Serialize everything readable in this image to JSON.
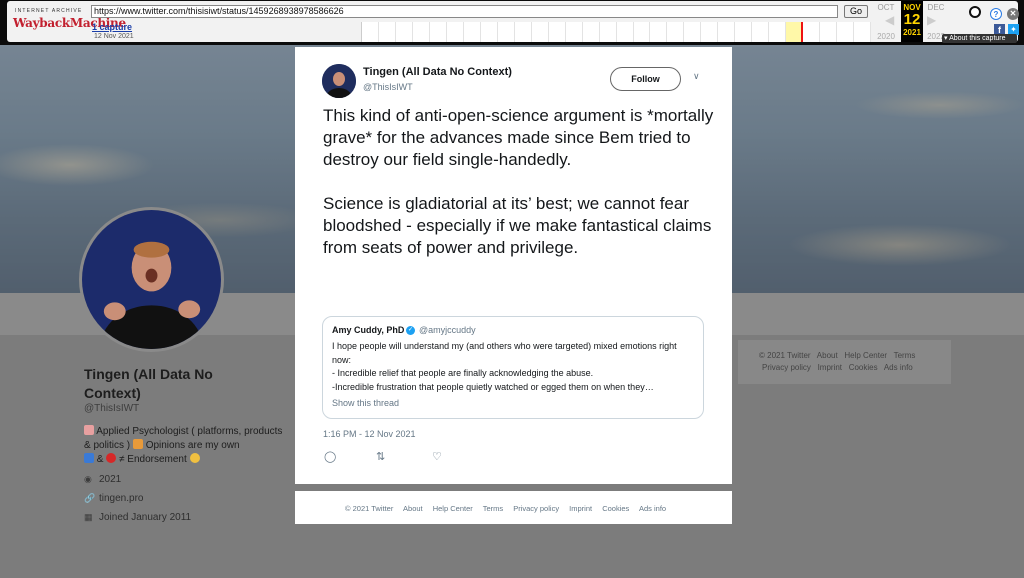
{
  "wayback": {
    "logo_top": "INTERNET ARCHIVE",
    "logo_main": "WaybackMachine",
    "url": "https://www.twitter.com/thisisiwt/status/1459268938978586626",
    "go_label": "Go",
    "captures_label": "1 capture",
    "capture_date": "12 Nov 2021",
    "prev_month": "OCT",
    "cur_month": "NOV",
    "next_month": "DEC",
    "cur_day": "12",
    "prev_year": "2020",
    "cur_year": "2021",
    "next_year": "2022",
    "about_label": "About this capture"
  },
  "profile": {
    "name": "Tingen (All Data No Context)",
    "handle": "@ThisIsIWT",
    "bio_line1": "Applied Psychologist ( platforms, products & politics )",
    "bio_line1_tail": "Opinions are my own",
    "bio_line2": "&",
    "bio_line2_tail": "≠ Endorsement",
    "location": "2021",
    "website": "tingen.pro",
    "joined": "Joined January 2011"
  },
  "side_footer": {
    "row1": [
      "© 2021 Twitter",
      "About",
      "Help Center",
      "Terms"
    ],
    "row2": [
      "Privacy policy",
      "Imprint",
      "Cookies",
      "Ads info"
    ]
  },
  "tweet": {
    "author_name": "Tingen (All Data No Context)",
    "author_handle": "@ThisIsIWT",
    "follow_label": "Follow",
    "body": "This kind of anti-open-science argument is *mortally grave* for the advances made since Bem tried to destroy our field single-handedly.\n\nScience is gladiatorial at its’ best; we cannot fear bloodshed - especially if we make fantastical claims from seats of power and privilege.",
    "timestamp": "1:16 PM - 12 Nov 2021"
  },
  "quote": {
    "author_name": "Amy Cuddy, PhD",
    "author_handle": "@amyjccuddy",
    "line1": "I hope people will understand my (and others who were targeted) mixed emotions right now:",
    "line2": "- Incredible relief that people are finally acknowledging the abuse.",
    "line3": "-Incredible frustration that people quietly watched or egged them on when they…",
    "show_thread": "Show this thread"
  },
  "footer": {
    "items": [
      "© 2021 Twitter",
      "About",
      "Help Center",
      "Terms",
      "Privacy policy",
      "Imprint",
      "Cookies",
      "Ads info"
    ]
  },
  "icons": {
    "reply": "reply-icon",
    "retweet": "retweet-icon",
    "like": "heart-icon"
  }
}
